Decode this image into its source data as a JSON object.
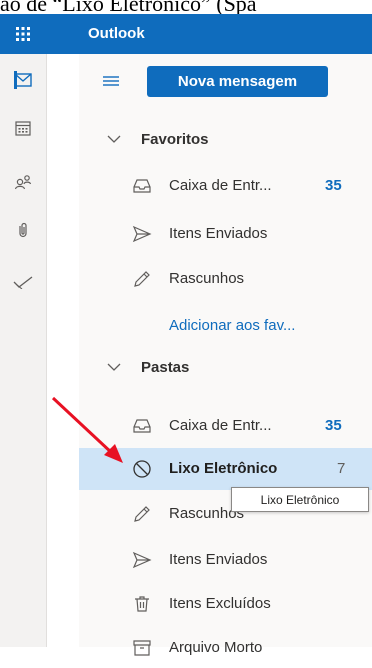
{
  "caption": "ão de “Lixo Eletrônico” (Spa",
  "header": {
    "title": "Outlook",
    "waffle_icon": "waffle-icon"
  },
  "rail": {
    "items": [
      {
        "icon": "mail-icon",
        "active": true
      },
      {
        "icon": "calendar-icon"
      },
      {
        "icon": "people-icon"
      },
      {
        "icon": "attachment-icon"
      },
      {
        "icon": "todo-icon"
      }
    ]
  },
  "toolbar": {
    "new_message": "Nova mensagem"
  },
  "favorites": {
    "title": "Favoritos",
    "items": [
      {
        "label": "Caixa de Entr...",
        "count": "35",
        "icon": "inbox-icon"
      },
      {
        "label": "Itens Enviados",
        "icon": "send-icon"
      },
      {
        "label": "Rascunhos",
        "icon": "pencil-icon"
      }
    ],
    "add_link": "Adicionar aos fav..."
  },
  "folders": {
    "title": "Pastas",
    "items": [
      {
        "label": "Caixa de Entr...",
        "count": "35",
        "icon": "inbox-icon"
      },
      {
        "label": "Lixo Eletrônico",
        "count": "7",
        "icon": "blocked-icon",
        "selected": true
      },
      {
        "label": "Rascunhos",
        "icon": "pencil-icon"
      },
      {
        "label": "Itens Enviados",
        "icon": "send-icon"
      },
      {
        "label": "Itens Excluídos",
        "icon": "trash-icon"
      },
      {
        "label": "Arquivo Morto",
        "icon": "archive-icon"
      }
    ]
  },
  "tooltip": "Lixo Eletrônico",
  "colors": {
    "brand": "#0f6cbd",
    "selected": "#cfe4f7",
    "annotation_arrow": "#e81123"
  }
}
